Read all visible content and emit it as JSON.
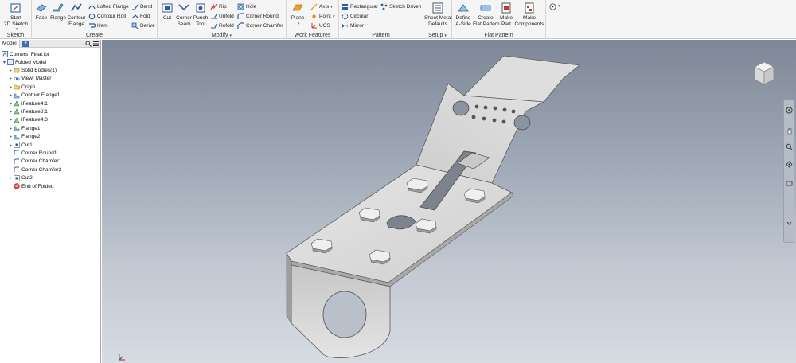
{
  "ribbon": {
    "panels": [
      {
        "title": "Sketch"
      },
      {
        "title": "Create"
      },
      {
        "title": "Modify"
      },
      {
        "title": "Work Features"
      },
      {
        "title": "Pattern"
      },
      {
        "title": "Setup"
      },
      {
        "title": "Flat Pattern"
      }
    ],
    "sketch": {
      "start_line1": "Start",
      "start_line2": "2D Sketch"
    },
    "create": {
      "face": "Face",
      "flange": "Flange",
      "contour_flange_l1": "Contour",
      "contour_flange_l2": "Flange",
      "lofted_flange": "Lofted Flange",
      "contour_roll": "Contour Roll",
      "hem": "Hem",
      "bend": "Bend",
      "fold": "Fold",
      "derive": "Derive"
    },
    "modify": {
      "cut": "Cut",
      "corner_seam_l1": "Corner",
      "corner_seam_l2": "Seam",
      "punch_tool_l1": "Punch",
      "punch_tool_l2": "Tool",
      "rip": "Rip",
      "unfold": "Unfold",
      "refold": "Refold",
      "hole": "Hole",
      "corner_round": "Corner Round",
      "corner_chamfer": "Corner Chamfer"
    },
    "work": {
      "plane": "Plane",
      "axis": "Axis",
      "point": "Point",
      "ucs": "UCS"
    },
    "pattern": {
      "rectangular": "Rectangular",
      "circular": "Circular",
      "mirror": "Mirror",
      "sketch_driven": "Sketch Driven"
    },
    "setup": {
      "defaults_l1": "Sheet Metal",
      "defaults_l2": "Defaults"
    },
    "flat": {
      "define_l1": "Define",
      "define_l2": "A-Side",
      "create_l1": "Create",
      "create_l2": "Flat Pattern",
      "make_part_l1": "Make",
      "make_part_l2": "Part",
      "make_comp_l1": "Make",
      "make_comp_l2": "Components"
    }
  },
  "browser": {
    "tab": "Model",
    "add": "+",
    "file": "Corners_Final.ipt",
    "items": [
      {
        "label": "Folded Model"
      },
      {
        "label": "Solid Bodies(1)"
      },
      {
        "label": "View: Master"
      },
      {
        "label": "Origin"
      },
      {
        "label": "Contour Flange1"
      },
      {
        "label": "iFeature4:1"
      },
      {
        "label": "iFeature8:1"
      },
      {
        "label": "iFeature4:3"
      },
      {
        "label": "Flange1"
      },
      {
        "label": "Flange2"
      },
      {
        "label": "Cut1"
      },
      {
        "label": "Corner Round1"
      },
      {
        "label": "Corner Chamfer1"
      },
      {
        "label": "Corner Chamfer2"
      },
      {
        "label": "Cut2"
      },
      {
        "label": "End of Folded"
      }
    ]
  },
  "colors": {
    "accent": "#3a6fb0",
    "viewport_top": "#7e8797",
    "viewport_bottom": "#d7dce3",
    "part_face": "#d9d9d9",
    "part_edge": "#5a5a5a"
  }
}
